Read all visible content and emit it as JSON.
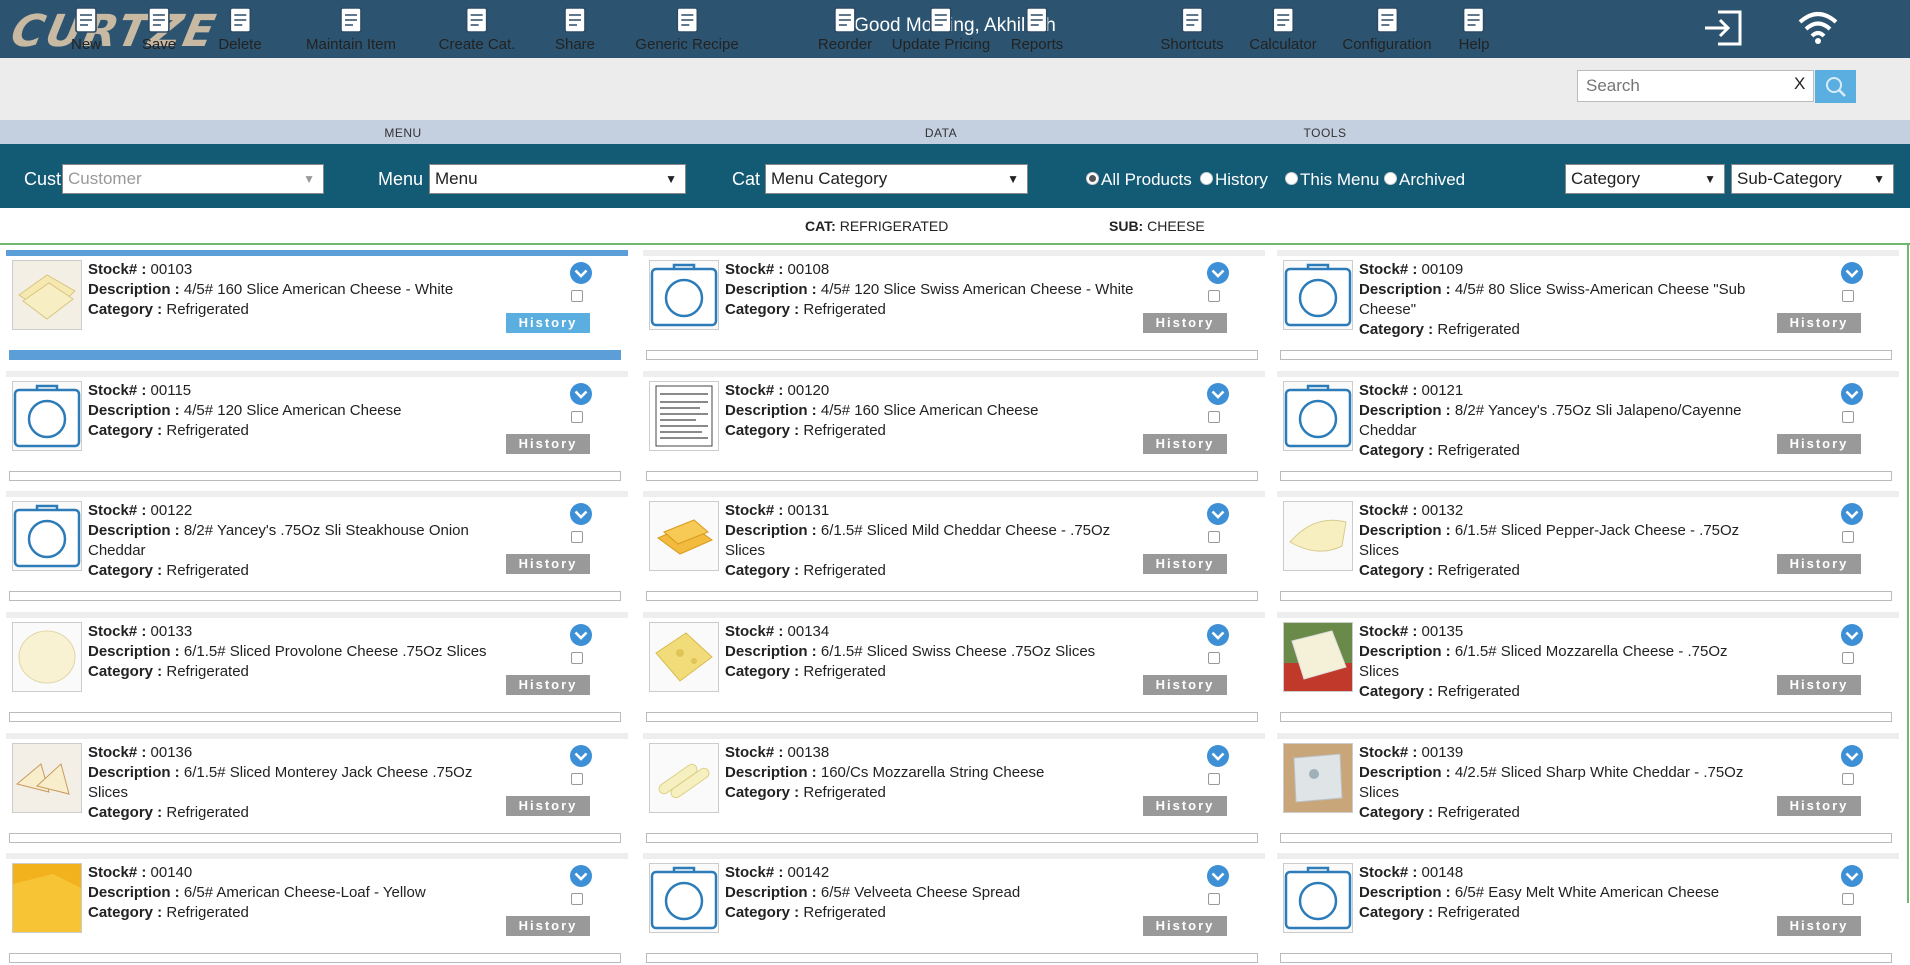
{
  "app": {
    "logo": "CURTZE",
    "greeting": "Good Morning, Akhilesh"
  },
  "toolbar": {
    "items": [
      {
        "label": "New",
        "icon": "new-document-icon"
      },
      {
        "label": "Save",
        "icon": "save-icon"
      },
      {
        "label": "Delete",
        "icon": "delete-document-icon"
      },
      {
        "label": "Maintain Item",
        "icon": "clipboard-icon"
      },
      {
        "label": "Create Cat.",
        "icon": "create-catalog-icon"
      },
      {
        "label": "Share",
        "icon": "share-document-icon"
      },
      {
        "label": "Generic Recipe",
        "icon": "recipe-icon"
      },
      {
        "label": "Reorder",
        "icon": "reorder-icon"
      },
      {
        "label": "Update Pricing",
        "icon": "pricing-icon"
      },
      {
        "label": "Reports",
        "icon": "reports-icon"
      },
      {
        "label": "Shortcuts",
        "icon": "shortcuts-icon"
      },
      {
        "label": "Calculator",
        "icon": "calculator-icon"
      },
      {
        "label": "Configuration",
        "icon": "configuration-icon"
      },
      {
        "label": "Help",
        "icon": "help-icon"
      }
    ],
    "sections": [
      "MENU",
      "DATA",
      "TOOLS"
    ],
    "search": {
      "placeholder": "Search",
      "clear": "X"
    }
  },
  "filters": {
    "cust_label": "Cust",
    "cust_placeholder": "Customer",
    "menu_label": "Menu",
    "menu_value": "Menu",
    "cat_label": "Cat",
    "cat_value": "Menu Category",
    "radios": [
      {
        "label": "All Products",
        "checked": true
      },
      {
        "label": "History",
        "checked": false
      },
      {
        "label": "This Menu",
        "checked": false
      },
      {
        "label": "Archived",
        "checked": false
      }
    ],
    "category_value": "Category",
    "subcategory_value": "Sub-Category"
  },
  "context": {
    "cat_key": "CAT:",
    "cat_value": "REFRIGERATED",
    "sub_key": "SUB:",
    "sub_value": "CHEESE"
  },
  "labels": {
    "stock": "Stock# :",
    "description": "Description :",
    "category": "Category :",
    "history": "History"
  },
  "products": [
    {
      "stock": "00103",
      "description": "4/5# 160 Slice American Cheese - White",
      "category": "Refrigerated",
      "image": "cheese-slices",
      "selected": true
    },
    {
      "stock": "00108",
      "description": "4/5# 120 Slice Swiss American Cheese - White",
      "category": "Refrigerated",
      "image": "placeholder"
    },
    {
      "stock": "00109",
      "description": "4/5# 80 Slice Swiss-American Cheese \"Sub Cheese\"",
      "category": "Refrigerated",
      "image": "placeholder"
    },
    {
      "stock": "00115",
      "description": "4/5# 120 Slice American Cheese",
      "category": "Refrigerated",
      "image": "placeholder"
    },
    {
      "stock": "00120",
      "description": "4/5# 160 Slice American Cheese",
      "category": "Refrigerated",
      "image": "nutrition-label"
    },
    {
      "stock": "00121",
      "description": "8/2# Yancey's .75Oz Sli Jalapeno/Cayenne Cheddar",
      "category": "Refrigerated",
      "image": "placeholder"
    },
    {
      "stock": "00122",
      "description": "8/2# Yancey's .75Oz Sli Steakhouse Onion Cheddar",
      "category": "Refrigerated",
      "image": "placeholder"
    },
    {
      "stock": "00131",
      "description": "6/1.5# Sliced Mild Cheddar Cheese - .75Oz Slices",
      "category": "Refrigerated",
      "image": "cheddar-slices"
    },
    {
      "stock": "00132",
      "description": "6/1.5# Sliced Pepper-Jack Cheese - .75Oz Slices",
      "category": "Refrigerated",
      "image": "pepperjack"
    },
    {
      "stock": "00133",
      "description": "6/1.5# Sliced Provolone Cheese .75Oz Slices",
      "category": "Refrigerated",
      "image": "provolone"
    },
    {
      "stock": "00134",
      "description": "6/1.5# Sliced Swiss Cheese .75Oz Slices",
      "category": "Refrigerated",
      "image": "swiss"
    },
    {
      "stock": "00135",
      "description": "6/1.5# Sliced Mozzarella Cheese - .75Oz Slices",
      "category": "Refrigerated",
      "image": "mozzarella"
    },
    {
      "stock": "00136",
      "description": "6/1.5# Sliced Monterey Jack Cheese .75Oz Slices",
      "category": "Refrigerated",
      "image": "monterey"
    },
    {
      "stock": "00138",
      "description": "160/Cs Mozzarella String Cheese",
      "category": "Refrigerated",
      "image": "string-cheese"
    },
    {
      "stock": "00139",
      "description": "4/2.5# Sliced Sharp White Cheddar - .75Oz Slices",
      "category": "Refrigerated",
      "image": "white-cheddar"
    },
    {
      "stock": "00140",
      "description": "6/5# American Cheese-Loaf - Yellow",
      "category": "Refrigerated",
      "image": "loaf"
    },
    {
      "stock": "00142",
      "description": "6/5# Velveeta Cheese Spread",
      "category": "Refrigerated",
      "image": "placeholder"
    },
    {
      "stock": "00148",
      "description": "6/5# Easy Melt White American Cheese",
      "category": "Refrigerated",
      "image": "placeholder"
    }
  ]
}
